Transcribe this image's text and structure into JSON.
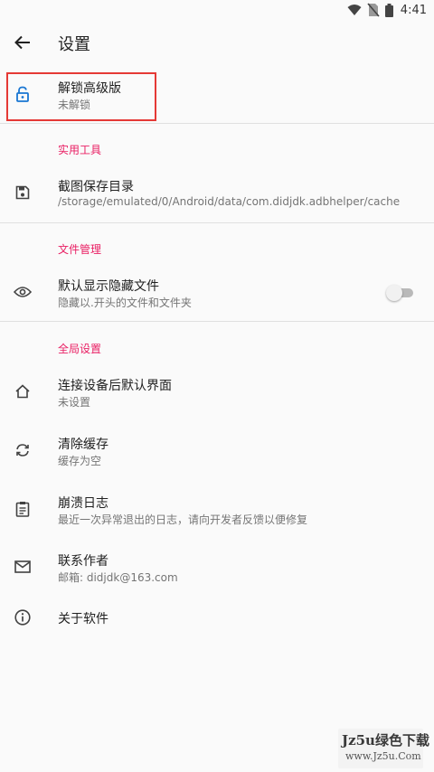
{
  "status_bar": {
    "time": "4:41"
  },
  "app_bar": {
    "title": "设置"
  },
  "unlock": {
    "title": "解锁高级版",
    "subtitle": "未解锁"
  },
  "sections": {
    "tools": "实用工具",
    "file_management": "文件管理",
    "global": "全局设置"
  },
  "items": {
    "screenshot_dir": {
      "title": "截图保存目录",
      "subtitle": "/storage/emulated/0/Android/data/com.didjdk.adbhelper/cache"
    },
    "show_hidden": {
      "title": "默认显示隐藏文件",
      "subtitle": "隐藏以.开头的文件和文件夹",
      "enabled": false
    },
    "default_screen": {
      "title": "连接设备后默认界面",
      "subtitle": "未设置"
    },
    "clear_cache": {
      "title": "清除缓存",
      "subtitle": "缓存为空"
    },
    "crash_log": {
      "title": "崩溃日志",
      "subtitle": "最近一次异常退出的日志，请向开发者反馈以便修复"
    },
    "contact": {
      "title": "联系作者",
      "subtitle": "邮箱: didjdk@163.com"
    },
    "about": {
      "title": "关于软件"
    }
  },
  "colors": {
    "accent": "#e91e63",
    "lock_icon": "#1976d2",
    "highlight": "#e53935"
  },
  "watermark": {
    "line1": "Jz5u绿色下载",
    "line2": "www.Jz5u.Com"
  }
}
